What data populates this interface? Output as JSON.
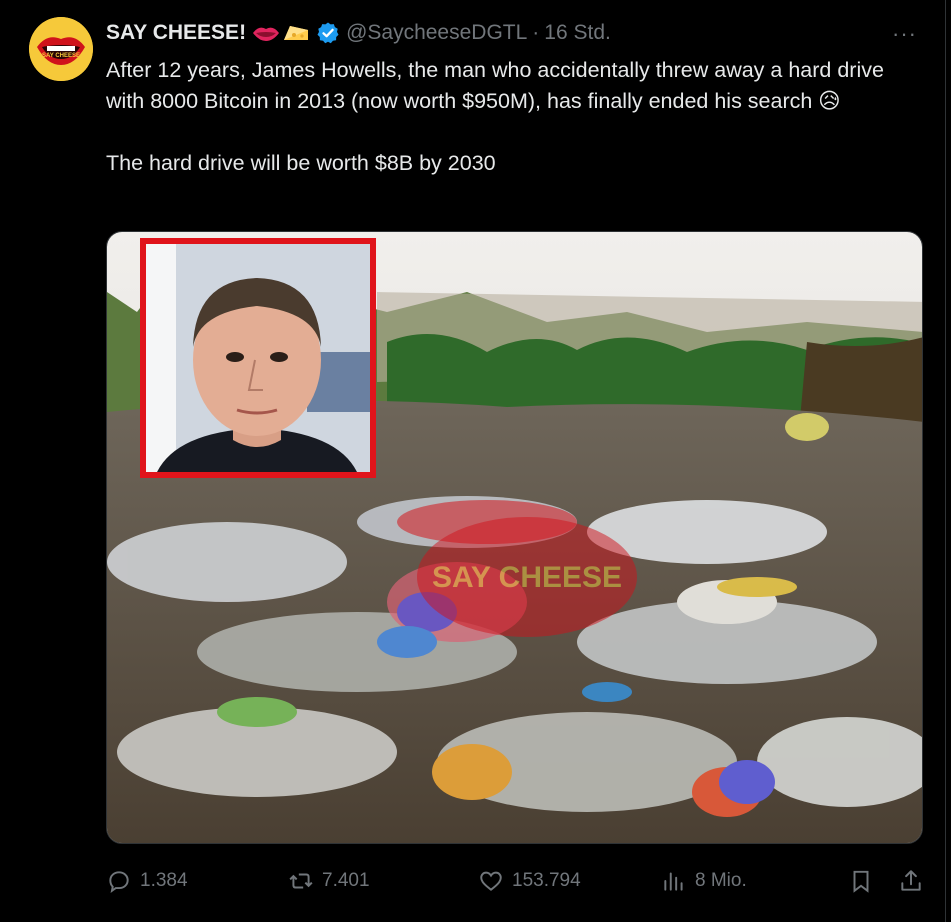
{
  "tweet": {
    "author_name": "SAY CHEESE!",
    "handle": "@SaycheeseDGTL",
    "separator": "·",
    "time": "16 Std.",
    "more": "···",
    "paragraph1": "After 12 years, James Howells, the man who accidentally threw away a hard drive with 8000 Bitcoin in 2013 (now worth $950M), has finally ended his search 😥",
    "paragraph2": "The hard drive will be worth $8B by 2030",
    "avatar_text": "SAY CHEESE",
    "media_watermark": "SAY CHEESE"
  },
  "actions": {
    "replies": "1.384",
    "reposts": "7.401",
    "likes": "153.794",
    "views": "8 Mio."
  },
  "icons": [
    "avatar-lips-logo",
    "lips-emoji",
    "cheese-emoji",
    "verified-badge-icon",
    "more-icon",
    "reply-icon",
    "repost-icon",
    "like-icon",
    "views-icon",
    "bookmark-icon",
    "share-icon"
  ],
  "colors": {
    "background": "#000000",
    "text": "#e7e9ea",
    "muted": "#71767b",
    "verified": "#1d9bf0",
    "avatar_bg": "#f6c93a",
    "inset_border": "#e0141b"
  }
}
